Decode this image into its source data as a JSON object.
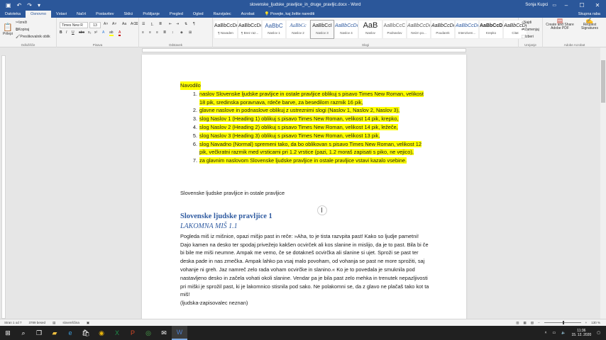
{
  "window": {
    "title": "slovenske_ljudske_pravljice_in_druge_pravljic.docx - Word",
    "search_placeholder": "Povejte, kaj želite narediti",
    "user": "Sonja Kupci",
    "share": "Skupna raba"
  },
  "tabs": [
    "Datoteka",
    "Osnovno",
    "Vstavi",
    "Načrt",
    "Postavitev",
    "Sklici",
    "Pošiljanje",
    "Pregled",
    "Ogled",
    "Razvijalec",
    "Acrobat"
  ],
  "ribbon": {
    "clipboard": {
      "paste": "Prilepi",
      "cut": "Izreži",
      "copy": "Kopiraj",
      "format_painter": "Preslikovalnik oblik",
      "label": "Odložišče"
    },
    "font": {
      "name": "Times New R",
      "size": "13",
      "label": "Pisava"
    },
    "paragraph": {
      "label": "Odstavek"
    },
    "styles": {
      "label": "Slogi",
      "items": [
        {
          "preview": "AaBbCcDc",
          "name": "¶ Navaden"
        },
        {
          "preview": "AaBbCcDc",
          "name": "¶ Brez raz..."
        },
        {
          "preview": "AaBbC",
          "name": "Naslov 1"
        },
        {
          "preview": "AaBbCc",
          "name": "Naslov 2"
        },
        {
          "preview": "AaBbCcI",
          "name": "Naslov 3"
        },
        {
          "preview": "AaBbCcDc",
          "name": "Naslov 4"
        },
        {
          "preview": "AaB",
          "name": "Naslov"
        },
        {
          "preview": "AaBbCcC",
          "name": "Podnaslov"
        },
        {
          "preview": "AaBbCcDc",
          "name": "Neizn po..."
        },
        {
          "preview": "AaBbCcDc",
          "name": "Poudarek"
        },
        {
          "preview": "AaBbCcDc",
          "name": "Intenziven..."
        },
        {
          "preview": "AaBbCcDc",
          "name": "Krepko"
        },
        {
          "preview": "AaBbCcDc",
          "name": "Citat"
        }
      ]
    },
    "editing": {
      "find": "Najdi",
      "replace": "Zamenjaj",
      "select": "Izberi",
      "label": "Urejanje"
    },
    "acrobat": {
      "create_share": "Create and Share Adobe PDF",
      "request_sig": "Request Signatures",
      "label": "Adobe Acrobat"
    }
  },
  "document": {
    "instructions_title": "Navodilo",
    "items": [
      {
        "num": "1.",
        "text": "naslov Slovenske ljudske pravljice in ostale pravljice oblikuj s pisavo Times New Roman, velikost 18 pik, sredinska poravnava, rdeče barve, za besedilom razmik 16 pik,"
      },
      {
        "num": "2.",
        "text": "glavne naslove in podnaslove oblikuj z ustreznimi slogi (Naslov 1, Naslov 2, Naslov 3),"
      },
      {
        "num": "3.",
        "text": "slog Naslov 1 (Heading 1) oblikuj s pisavo Times New Roman, velikost 14 pik, krepko,"
      },
      {
        "num": "4.",
        "text": "slog Naslov 2 (Heading 2) oblikuj s pisavo Times New Roman, velikost 14 pik, ležeče,"
      },
      {
        "num": "5.",
        "text": "slog Naslov 3 (Heading 3) oblikuj s pisavo Times New Roman, velikost 13 pik,"
      },
      {
        "num": "6.",
        "text": "slog Navadno (Normal) spremeni tako, da bo oblikovan s pisavo Times New Roman, velikost 12 pik, večkratni razmik med vrsticami pri 1.2 vrstice (pazi, 1.2 moraš zapisati s piko, ne vejico),"
      },
      {
        "num": "7.",
        "text": "za glavnim naslovom Slovenske ljudske pravljice in ostale pravljice vstavi kazalo vsebine."
      }
    ],
    "main_title": "Slovenske ljudske pravljice in ostale pravljice",
    "heading1": "Slovenske ljudske pravljice 1",
    "heading2": "LAKOMNA MIŠ 1.1",
    "body": "Pogleda miš iz mišnice, opazi mišjo past in reče: »Aha, to je tista razvpita past! Kako so ljudje pametni! Dajo kamen na desko ter spodaj privežejo kakšen ocvirček ali kos slanine in mislijo, da je to past. Bila bi če bi bile me miši neumne. Ampak me vemo, če se dotakneš ocvirčka ali slanine si ujet. Sproži se past ter deska pade in nas zmečka. Ampak lahko pa vsaj malo povoham, od vohanja se past ne more sprožiti, saj vohanje ni greh. Jaz namreč zelo rada voham ocvirčke in slanino.« Ko je to povedala je smuknila pod nastavljeno desko in začela vohati okoli slanine. Vendar pa je bila past zelo mehka in trenutek nepazljivosti pri miški je sprožil past, ki je lakomnico stisnila pod sako. Ne polakomni se, da z glavo ne plačaš tako kot ta miš!",
    "source": "(ljudska-zapisovalec neznan)"
  },
  "status": {
    "page": "Stran 1 od 7",
    "words": "3789 besed",
    "language": "slovenščina",
    "zoom": "130 %"
  },
  "taskbar": {
    "time": "11:36",
    "date": "15. 12. 2020"
  },
  "colors": {
    "word_blue": "#2b579a",
    "highlight": "#ffff00",
    "heading": "#2e5aa0"
  }
}
